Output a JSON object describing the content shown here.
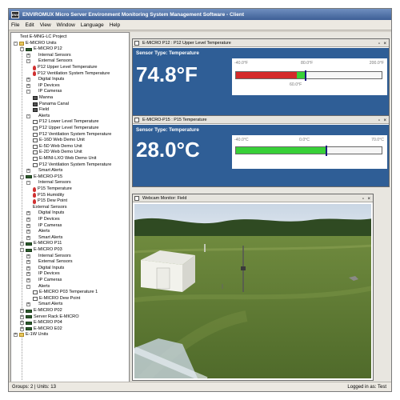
{
  "window": {
    "title": "ENVIROMUX Micro Server Environment Monitoring System Management Software - Client",
    "app_icon_label": "ENV"
  },
  "menu": [
    "File",
    "Edit",
    "View",
    "Window",
    "Language",
    "Help"
  ],
  "tree": [
    {
      "label": "Test E-MNG-LC Project",
      "depth": 0,
      "toggle": "",
      "icon": "ic-plain"
    },
    {
      "label": "E-MICRO Units",
      "depth": 0,
      "toggle": "-",
      "icon": "ic-folder"
    },
    {
      "label": "E-MICRO P12",
      "depth": 1,
      "toggle": "-",
      "icon": "ic-device"
    },
    {
      "label": "Internal Sensors",
      "depth": 2,
      "toggle": "+",
      "icon": "ic-plain"
    },
    {
      "label": "External Sensors",
      "depth": 2,
      "toggle": "-",
      "icon": "ic-plain"
    },
    {
      "label": "P12 Upper Level Temperature",
      "depth": 3,
      "toggle": "",
      "icon": "ic-sensor"
    },
    {
      "label": "P12 Ventilation System Temperature",
      "depth": 3,
      "toggle": "",
      "icon": "ic-sensor"
    },
    {
      "label": "Digital Inputs",
      "depth": 2,
      "toggle": "+",
      "icon": "ic-plain"
    },
    {
      "label": "IP Devices",
      "depth": 2,
      "toggle": "+",
      "icon": "ic-plain"
    },
    {
      "label": "IP Cameras",
      "depth": 2,
      "toggle": "-",
      "icon": "ic-plain"
    },
    {
      "label": "Manna",
      "depth": 3,
      "toggle": "",
      "icon": "ic-cam"
    },
    {
      "label": "Panama Canal",
      "depth": 3,
      "toggle": "",
      "icon": "ic-cam"
    },
    {
      "label": "Field",
      "depth": 3,
      "toggle": "",
      "icon": "ic-cam"
    },
    {
      "label": "Alerts",
      "depth": 2,
      "toggle": "-",
      "icon": "ic-plain"
    },
    {
      "label": "P12 Lower Level Temperature",
      "depth": 3,
      "toggle": "",
      "icon": "ic-alert"
    },
    {
      "label": "P12 Upper Level Temperature",
      "depth": 3,
      "toggle": "",
      "icon": "ic-alert"
    },
    {
      "label": "P12 Ventilation System Temperature",
      "depth": 3,
      "toggle": "",
      "icon": "ic-alert"
    },
    {
      "label": "E-16D Web Demo Unit",
      "depth": 3,
      "toggle": "",
      "icon": "ic-alert"
    },
    {
      "label": "E-5D Web Demo Unit",
      "depth": 3,
      "toggle": "",
      "icon": "ic-alert"
    },
    {
      "label": "E-2D Web Demo Unit",
      "depth": 3,
      "toggle": "",
      "icon": "ic-alert"
    },
    {
      "label": "E-MINI-LXO Web Demo Unit",
      "depth": 3,
      "toggle": "",
      "icon": "ic-alert"
    },
    {
      "label": "P12 Ventilation System Temperature",
      "depth": 3,
      "toggle": "",
      "icon": "ic-alert"
    },
    {
      "label": "Smart Alerts",
      "depth": 2,
      "toggle": "+",
      "icon": "ic-plain"
    },
    {
      "label": "E-MICRO-P15",
      "depth": 1,
      "toggle": "-",
      "icon": "ic-device"
    },
    {
      "label": "Internal Sensors",
      "depth": 2,
      "toggle": "-",
      "icon": "ic-plain"
    },
    {
      "label": "P15 Temperature",
      "depth": 3,
      "toggle": "",
      "icon": "ic-sensor"
    },
    {
      "label": "P15 Humidity",
      "depth": 3,
      "toggle": "",
      "icon": "ic-sensor"
    },
    {
      "label": "P15 Dew Point",
      "depth": 3,
      "toggle": "",
      "icon": "ic-sensor"
    },
    {
      "label": "External Sensors",
      "depth": 2,
      "toggle": "",
      "icon": "ic-plain"
    },
    {
      "label": "Digital Inputs",
      "depth": 2,
      "toggle": "+",
      "icon": "ic-plain"
    },
    {
      "label": "IP Devices",
      "depth": 2,
      "toggle": "+",
      "icon": "ic-plain"
    },
    {
      "label": "IP Cameras",
      "depth": 2,
      "toggle": "+",
      "icon": "ic-plain"
    },
    {
      "label": "Alerts",
      "depth": 2,
      "toggle": "+",
      "icon": "ic-plain"
    },
    {
      "label": "Smart Alerts",
      "depth": 2,
      "toggle": "+",
      "icon": "ic-plain"
    },
    {
      "label": "E-MICRO P11",
      "depth": 1,
      "toggle": "+",
      "icon": "ic-device"
    },
    {
      "label": "E-MICRO P03",
      "depth": 1,
      "toggle": "-",
      "icon": "ic-device"
    },
    {
      "label": "Internal Sensors",
      "depth": 2,
      "toggle": "+",
      "icon": "ic-plain"
    },
    {
      "label": "External Sensors",
      "depth": 2,
      "toggle": "+",
      "icon": "ic-plain"
    },
    {
      "label": "Digital Inputs",
      "depth": 2,
      "toggle": "+",
      "icon": "ic-plain"
    },
    {
      "label": "IP Devices",
      "depth": 2,
      "toggle": "+",
      "icon": "ic-plain"
    },
    {
      "label": "IP Cameras",
      "depth": 2,
      "toggle": "+",
      "icon": "ic-plain"
    },
    {
      "label": "Alerts",
      "depth": 2,
      "toggle": "-",
      "icon": "ic-plain"
    },
    {
      "label": "E-MICRO P03 Temperature 1",
      "depth": 3,
      "toggle": "",
      "icon": "ic-alert"
    },
    {
      "label": "E-MICRO Dew Point",
      "depth": 3,
      "toggle": "",
      "icon": "ic-alert"
    },
    {
      "label": "Smart Alerts",
      "depth": 2,
      "toggle": "+",
      "icon": "ic-plain"
    },
    {
      "label": "E-MICRO P02",
      "depth": 1,
      "toggle": "+",
      "icon": "ic-device"
    },
    {
      "label": "Server Rack E-MICRO",
      "depth": 1,
      "toggle": "+",
      "icon": "ic-device"
    },
    {
      "label": "E-MICRO P04",
      "depth": 1,
      "toggle": "+",
      "icon": "ic-device"
    },
    {
      "label": "E-MICRO E02",
      "depth": 1,
      "toggle": "+",
      "icon": "ic-device"
    },
    {
      "label": "E-1W Units",
      "depth": 0,
      "toggle": "+",
      "icon": "ic-folder"
    }
  ],
  "sensor_p12": {
    "title": "E-MICRO P12 : P12 Upper Level Temperature",
    "type_label": "Sensor Type: Temperature",
    "value": "74.8°F",
    "min_label": "-40.0°F",
    "mid_label": "80.0°F",
    "max_label": "200.0°F",
    "sub_label": "60.0°F",
    "range_min": -40,
    "range_max": 200,
    "reading": 74.8,
    "green_from": 60,
    "green_to": 80,
    "colors": {
      "red": "#d42a2a",
      "green": "#38d038"
    }
  },
  "sensor_p15": {
    "title": "E-MICRO-P15 : P15 Temperature",
    "type_label": "Sensor Type: Temperature",
    "value": "28.0°C",
    "min_label": "-40.0°C",
    "mid_label": "0.0°C",
    "max_label": "70.0°C",
    "range_min": -40,
    "range_max": 70,
    "reading": 28.0,
    "colors": {
      "green": "#38d038"
    }
  },
  "webcam": {
    "title": "Webcam Monitor: Field"
  },
  "status": {
    "left": "Groups: 2 | Units: 13",
    "right": "Logged in as: Test"
  },
  "theme": {
    "panel_blue": "#2f5e96"
  }
}
